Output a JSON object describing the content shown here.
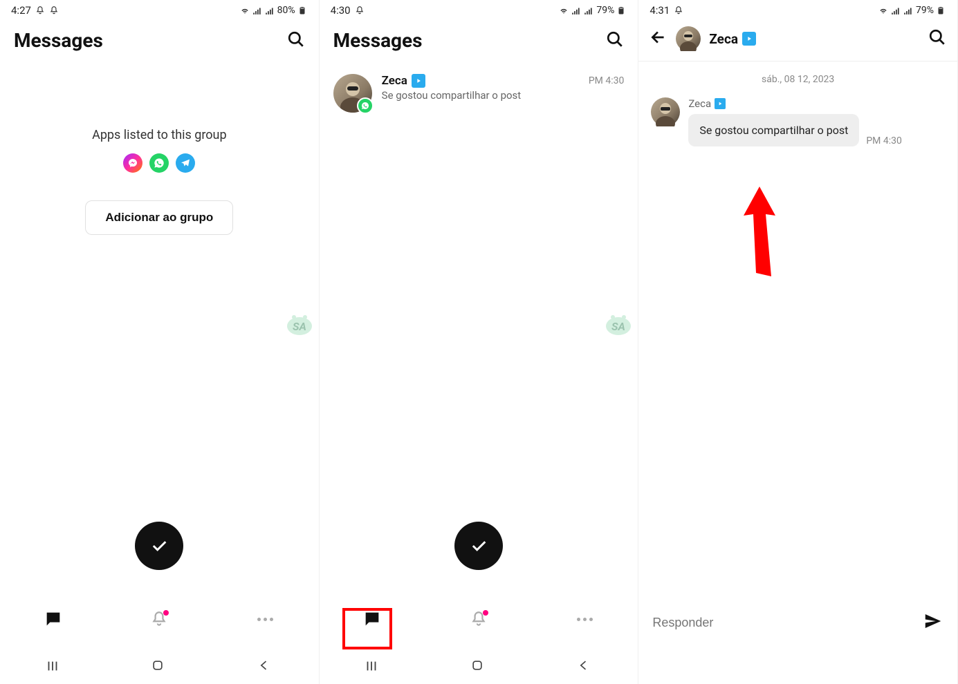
{
  "screen1": {
    "status": {
      "time": "4:27",
      "battery": "80%"
    },
    "title": "Messages",
    "apps_listed": "Apps listed to this group",
    "add_button": "Adicionar ao grupo"
  },
  "screen2": {
    "status": {
      "time": "4:30",
      "battery": "79%"
    },
    "title": "Messages",
    "chat": {
      "name": "Zeca",
      "preview": "Se gostou compartilhar o post",
      "time": "PM 4:30"
    }
  },
  "screen3": {
    "status": {
      "time": "4:31",
      "battery": "79%"
    },
    "name": "Zeca",
    "date": "sáb., 08 12, 2023",
    "msg_sender": "Zeca",
    "msg_text": "Se gostou compartilhar o post",
    "msg_time": "PM 4:30",
    "compose_placeholder": "Responder"
  }
}
